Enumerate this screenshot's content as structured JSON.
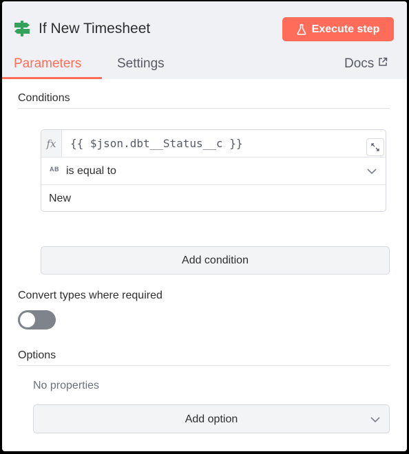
{
  "header": {
    "node_icon": "signpost-icon",
    "title": "If New Timesheet",
    "execute_label": "Execute step",
    "execute_icon": "flask-icon",
    "accent_color": "#ff6d5a"
  },
  "tabs": [
    {
      "label": "Parameters",
      "active": true
    },
    {
      "label": "Settings",
      "active": false
    }
  ],
  "docs": {
    "label": "Docs",
    "icon": "external-link-icon"
  },
  "conditions": {
    "section_title": "Conditions",
    "expression_prefix": "fx",
    "expression": "{{ $json.dbt__Status__c }}",
    "type_icon_label": "AB",
    "operator": "is equal to",
    "value": "New",
    "add_condition_label": "Add condition"
  },
  "convert_types": {
    "label": "Convert types where required",
    "enabled": false
  },
  "options": {
    "section_title": "Options",
    "empty_text": "No properties",
    "add_option_label": "Add option"
  }
}
